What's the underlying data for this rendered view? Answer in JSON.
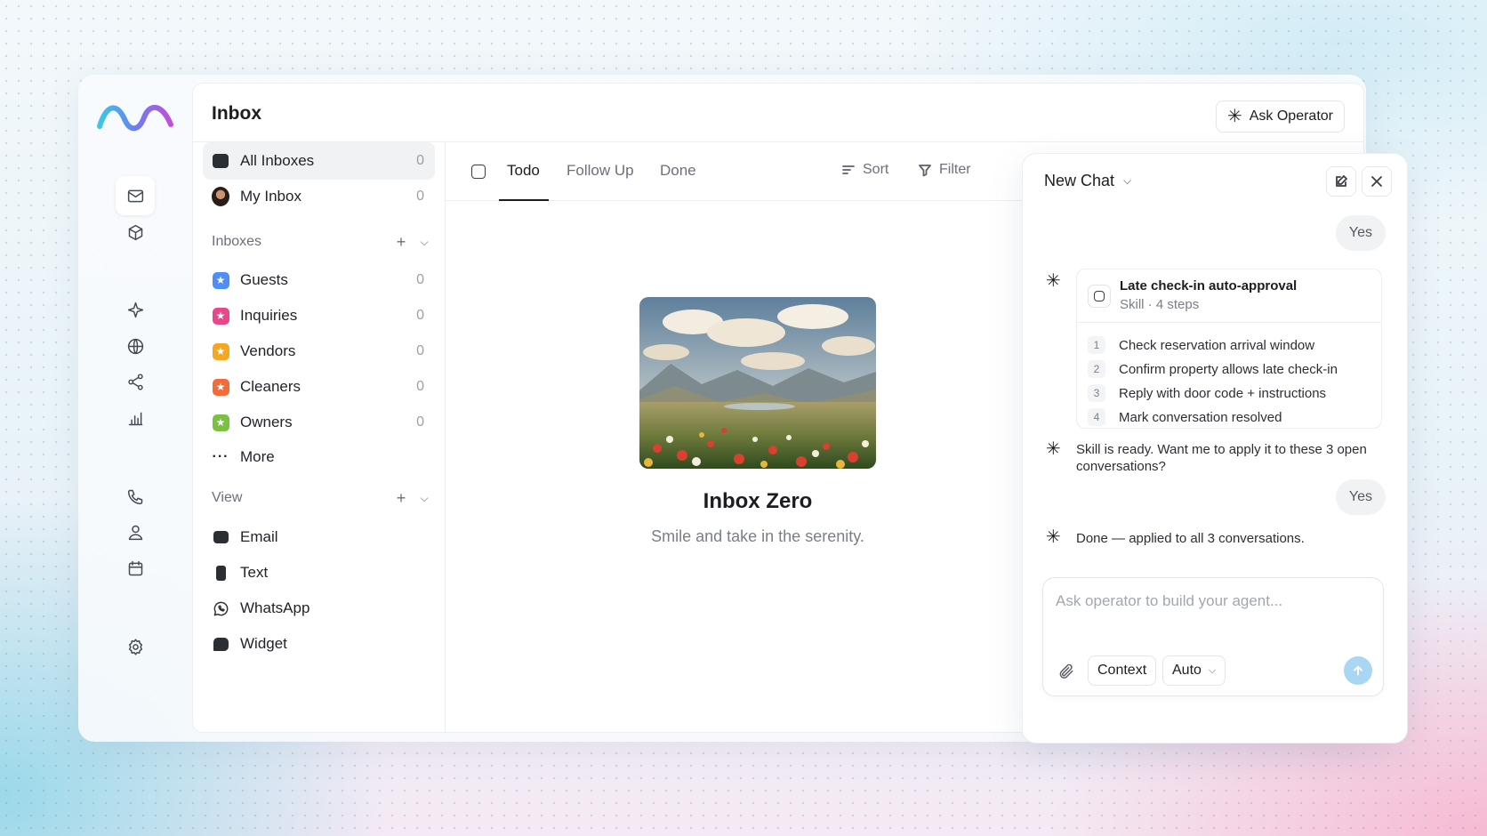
{
  "header": {
    "title": "Inbox",
    "ask_operator_label": "Ask Operator"
  },
  "primary": {
    "all_inboxes": {
      "label": "All Inboxes",
      "count": "0"
    },
    "my_inbox": {
      "label": "My Inbox",
      "count": "0"
    }
  },
  "inboxes": {
    "heading": "Inboxes",
    "items": [
      {
        "label": "Guests",
        "count": "0",
        "color": "#4f8ef7"
      },
      {
        "label": "Inquiries",
        "count": "0",
        "color": "#e8478b"
      },
      {
        "label": "Vendors",
        "count": "0",
        "color": "#f5a623"
      },
      {
        "label": "Cleaners",
        "count": "0",
        "color": "#f26b3a"
      },
      {
        "label": "Owners",
        "count": "0",
        "color": "#7bc043"
      }
    ],
    "more_label": "More"
  },
  "view": {
    "heading": "View",
    "items": [
      {
        "label": "Email",
        "icon": "mail-icon"
      },
      {
        "label": "Text",
        "icon": "phone-text-icon"
      },
      {
        "label": "WhatsApp",
        "icon": "whatsapp-icon"
      },
      {
        "label": "Widget",
        "icon": "widget-icon"
      }
    ]
  },
  "tabs": {
    "todo": "Todo",
    "follow_up": "Follow Up",
    "done": "Done",
    "sort": "Sort",
    "filter": "Filter"
  },
  "empty": {
    "title": "Inbox Zero",
    "subtitle": "Smile and take in the serenity."
  },
  "chat": {
    "title": "New Chat",
    "user_msg_1": "Yes",
    "skill": {
      "name": "Late check-in auto-approval",
      "meta": "Skill · 4 steps",
      "steps": [
        {
          "num": "1",
          "text": "Check reservation arrival window"
        },
        {
          "num": "2",
          "text": "Confirm property allows late check-in"
        },
        {
          "num": "3",
          "text": "Reply with door code + instructions"
        },
        {
          "num": "4",
          "text": "Mark conversation resolved"
        }
      ]
    },
    "assistant_msg_1": "Skill is ready. Want me to apply it to these 3 open conversations?",
    "user_msg_2": "Yes",
    "assistant_msg_2": "Done — applied to all 3 conversations.",
    "composer": {
      "placeholder": "Ask operator to build your agent...",
      "context_label": "Context",
      "mode_label": "Auto"
    }
  }
}
